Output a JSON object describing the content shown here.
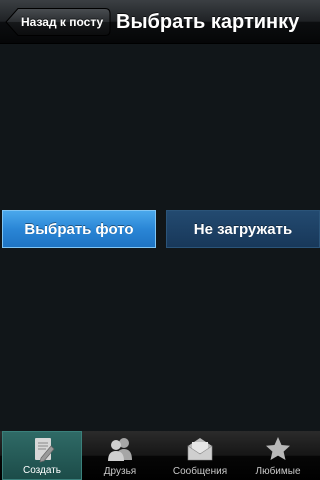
{
  "nav": {
    "back_label": "Назад к посту",
    "title": "Выбрать картинку"
  },
  "main": {
    "choose_photo_label": "Выбрать фото",
    "skip_upload_label": "Не загружать"
  },
  "tabbar": {
    "tabs": [
      {
        "label": "Создать",
        "icon": "compose-icon",
        "active": true
      },
      {
        "label": "Друзья",
        "icon": "friends-icon",
        "active": false
      },
      {
        "label": "Сообщения",
        "icon": "messages-icon",
        "active": false
      },
      {
        "label": "Любимые",
        "icon": "star-icon",
        "active": false
      }
    ]
  },
  "colors": {
    "background": "#111619",
    "primary_button": "#2a86d6",
    "secondary_button": "#1c3f63",
    "active_tab": "#245c58"
  }
}
